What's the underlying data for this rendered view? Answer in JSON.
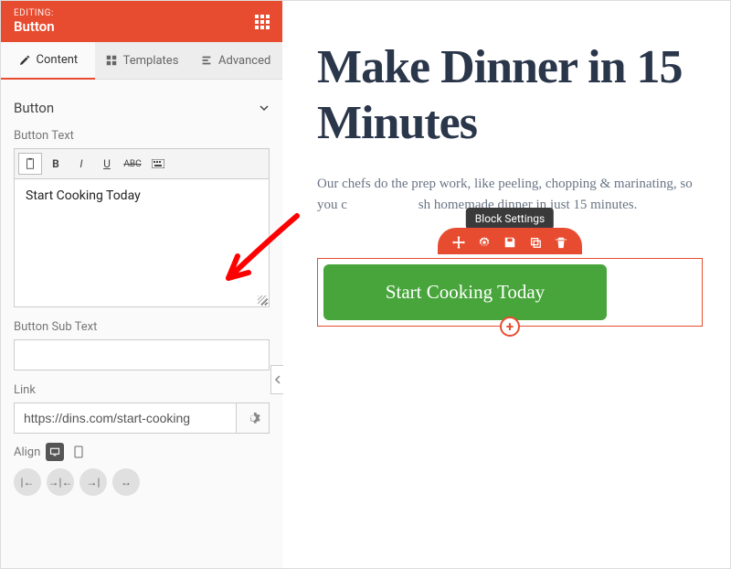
{
  "header": {
    "editing_label": "EDITING:",
    "title": "Button"
  },
  "tabs": {
    "content": "Content",
    "templates": "Templates",
    "advanced": "Advanced"
  },
  "section": {
    "title": "Button"
  },
  "fields": {
    "button_text_label": "Button Text",
    "button_text_value": "Start Cooking Today",
    "button_sub_text_label": "Button Sub Text",
    "button_sub_text_value": "",
    "link_label": "Link",
    "link_value": "https://dins.com/start-cooking",
    "align_label": "Align"
  },
  "canvas": {
    "headline": "Make Dinner in 15 Minutes",
    "subtext_before": "Our chefs do the prep work, like peeling, chopping & marinating, so you ",
    "subtext_obscured_1": "c",
    "subtext_obscured_2": "sh ",
    "subtext_after": "homemade dinner in just 15 minutes.",
    "button_label": "Start Cooking Today",
    "tooltip": "Block Settings"
  },
  "colors": {
    "accent": "#e84c30",
    "cta": "#48a53b",
    "headline": "#2a364a"
  }
}
